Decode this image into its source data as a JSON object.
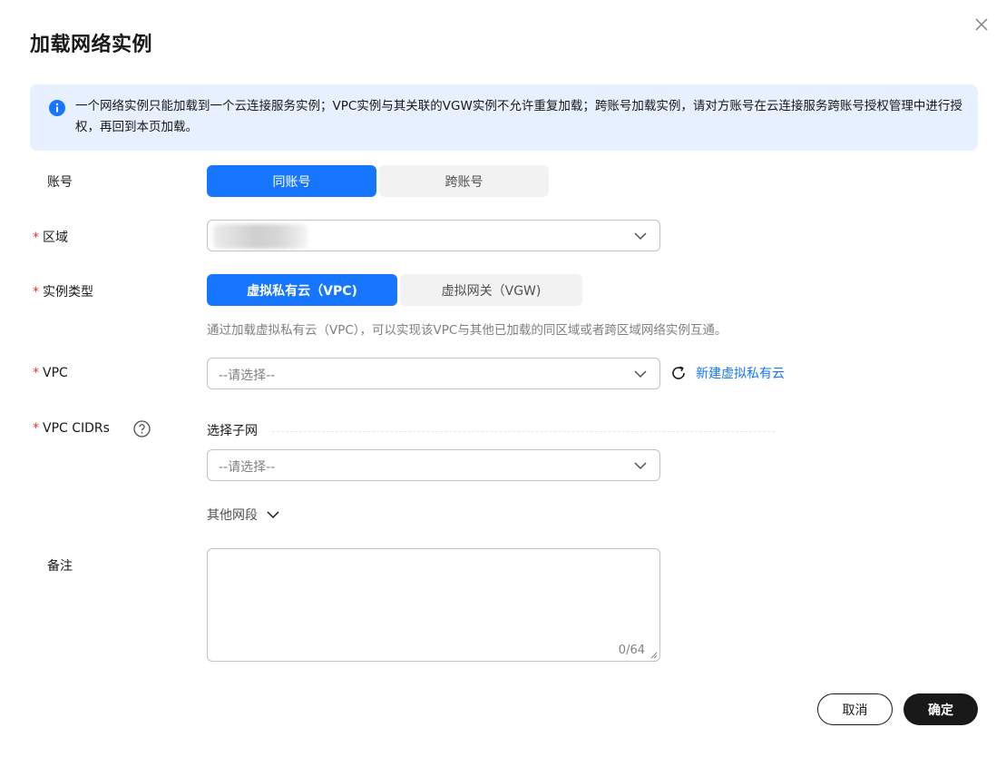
{
  "dialog": {
    "title": "加载网络实例"
  },
  "notice": {
    "text": "一个网络实例只能加载到一个云连接服务实例；VPC实例与其关联的VGW实例不允许重复加载；跨账号加载实例，请对方账号在云连接服务跨账号授权管理中进行授权，再回到本页加载。"
  },
  "form": {
    "account": {
      "label": "账号",
      "options": [
        "同账号",
        "跨账号"
      ],
      "selected": "同账号"
    },
    "region": {
      "label": "区域",
      "value": ""
    },
    "instance_type": {
      "label": "实例类型",
      "options": [
        "虚拟私有云（VPC)",
        "虚拟网关（VGW)"
      ],
      "selected": "虚拟私有云（VPC)",
      "hint": "通过加载虚拟私有云（VPC），可以实现该VPC与其他已加载的同区域或者跨区域网络实例互通。"
    },
    "vpc": {
      "label": "VPC",
      "placeholder": "--请选择--",
      "create_link": "新建虚拟私有云"
    },
    "vpc_cidrs": {
      "label": "VPC CIDRs",
      "subnet_title": "选择子网",
      "placeholder": "--请选择--",
      "other_segments": "其他网段"
    },
    "remark": {
      "label": "备注",
      "value": "",
      "counter": "0/64"
    }
  },
  "footer": {
    "cancel": "取消",
    "confirm": "确定"
  },
  "colors": {
    "primary": "#1676ff",
    "required": "#e5332d",
    "notice_bg": "#e6f0fe",
    "confirm_bg": "#191919"
  }
}
